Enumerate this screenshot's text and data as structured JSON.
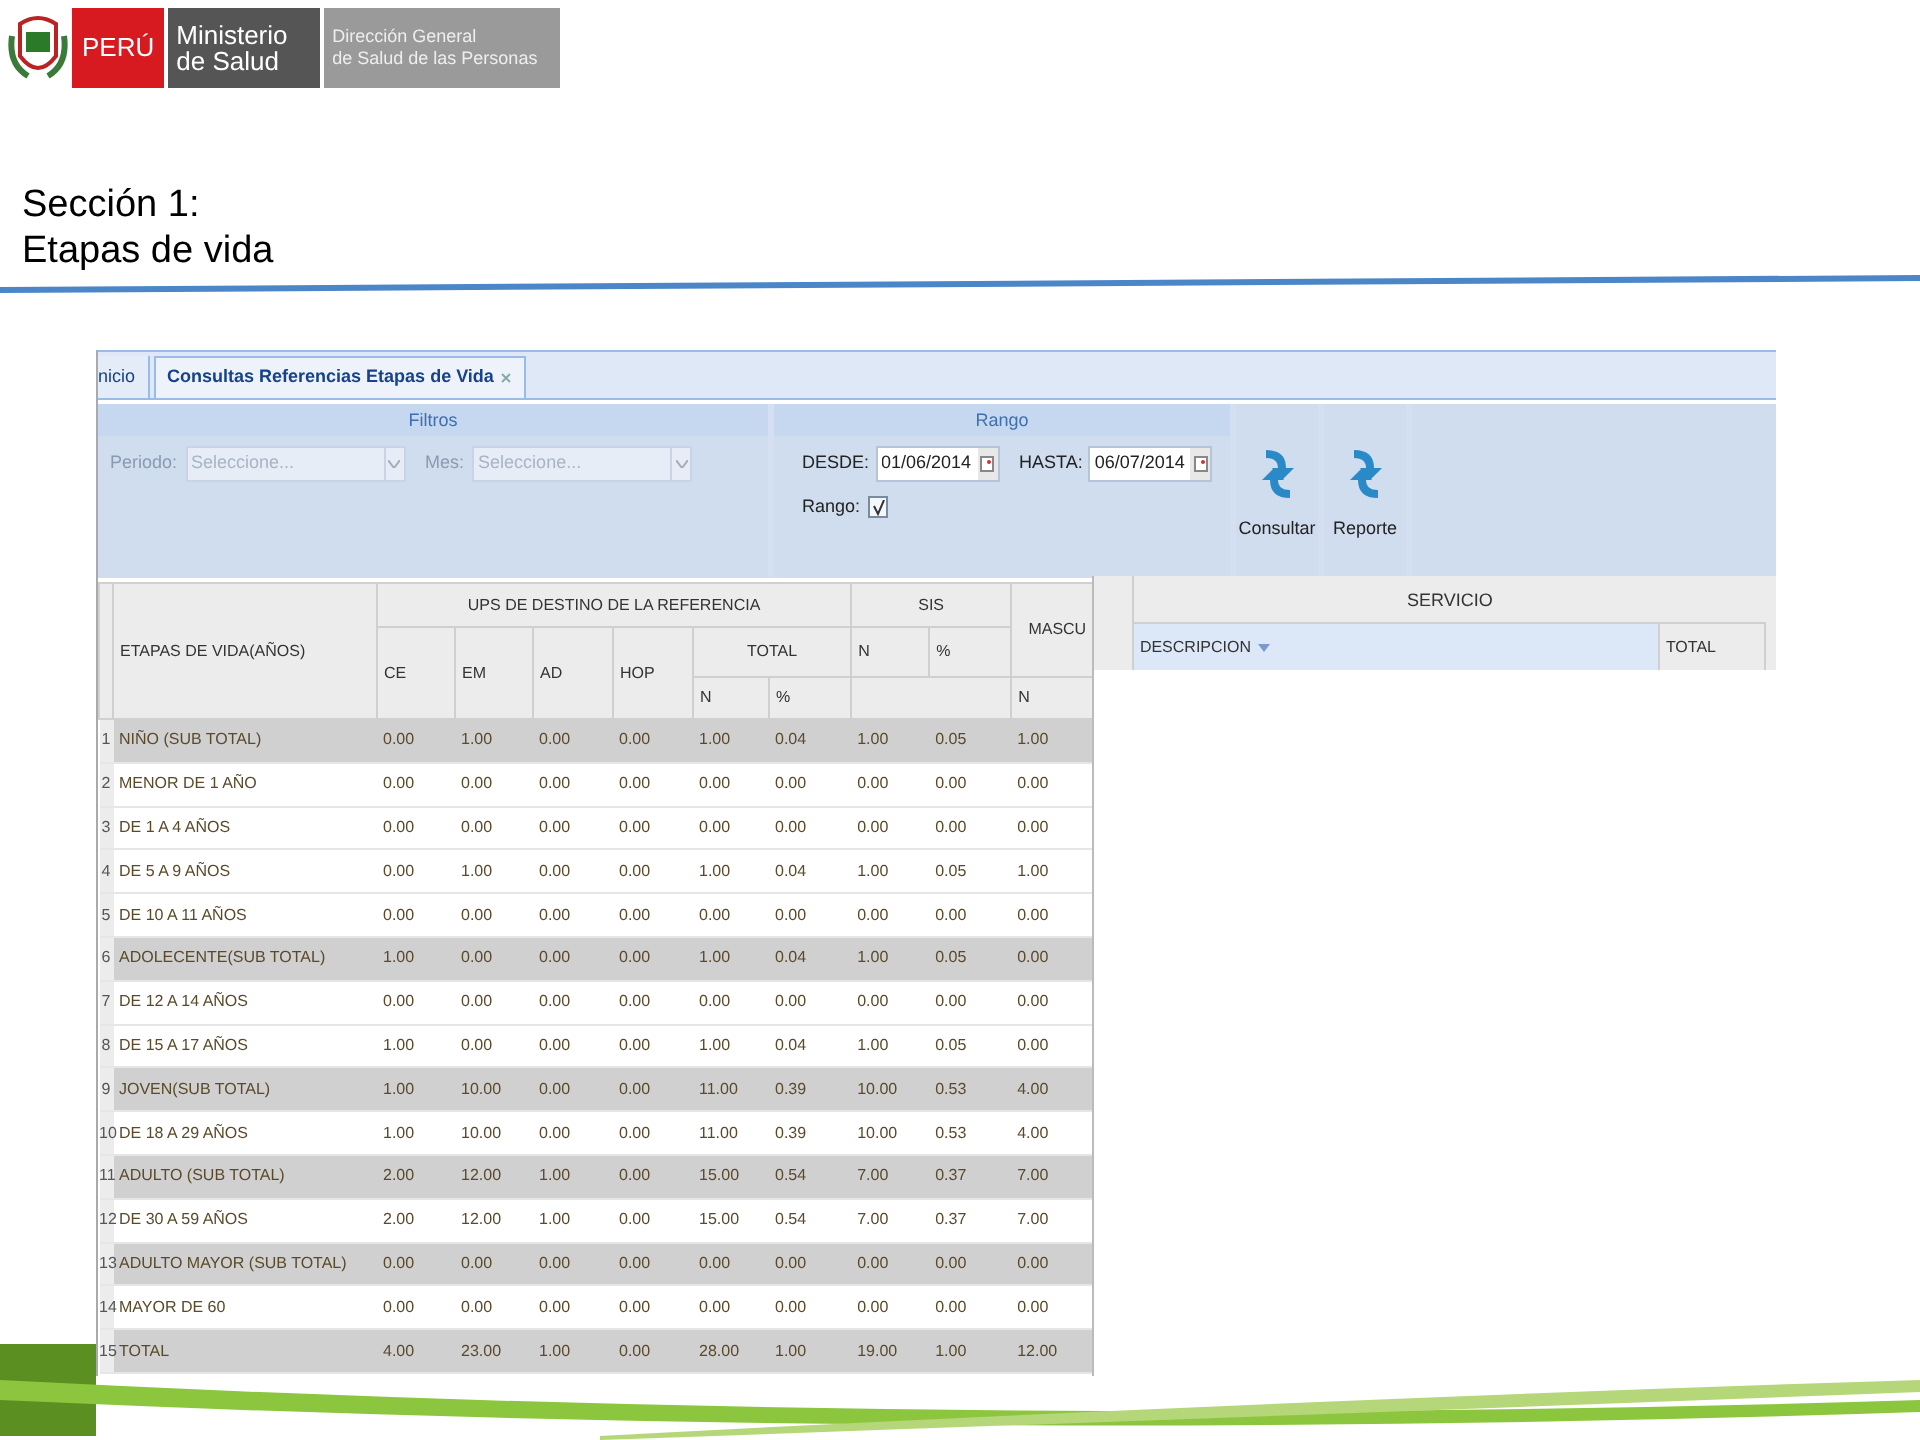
{
  "logo": {
    "country": "PERÚ",
    "ministry": [
      "Ministerio",
      "de Salud"
    ],
    "office": [
      "Dirección General",
      "de Salud de las Personas"
    ]
  },
  "slide_title": [
    "Sección 1:",
    "Etapas de vida"
  ],
  "tabs": [
    {
      "label": "nicio",
      "selected": false,
      "closable": false
    },
    {
      "label": "Consultas Referencias Etapas de Vida",
      "selected": true,
      "closable": true
    }
  ],
  "filters": {
    "title": "Filtros",
    "fields": [
      {
        "label": "Periodo:",
        "placeholder": "Seleccione...",
        "disabled": true
      },
      {
        "label": "Mes:",
        "placeholder": "Seleccione...",
        "disabled": true
      }
    ]
  },
  "range": {
    "title": "Rango",
    "dates": [
      {
        "label": "DESDE:",
        "value": "01/06/2014"
      },
      {
        "label": "HASTA:",
        "value": "06/07/2014"
      }
    ],
    "checkbox": {
      "label": "Rango:",
      "checked": true
    }
  },
  "actions": [
    {
      "label": "Consultar"
    },
    {
      "label": "Reporte"
    }
  ],
  "grid": {
    "header": {
      "stages": "ETAPAS DE VIDA(AÑOS)",
      "ups": "UPS DE DESTINO DE LA REFERENCIA",
      "ups_columns": [
        "CE",
        "EM",
        "AD",
        "HOP"
      ],
      "total": "TOTAL",
      "total_columns": [
        "N",
        "%"
      ],
      "sis": "SIS",
      "sis_columns": [
        "N",
        "%"
      ],
      "male": "MASCU",
      "male_columns": [
        "N"
      ]
    },
    "rows": [
      {
        "number": "1",
        "label": "NIÑO (SUB TOTAL)",
        "kind": "subtotal",
        "values": [
          "0.00",
          "1.00",
          "0.00",
          "0.00",
          "1.00",
          "0.04",
          "1.00",
          "0.05",
          "1.00"
        ]
      },
      {
        "number": "2",
        "label": "MENOR DE 1 AÑO",
        "kind": "detail",
        "values": [
          "0.00",
          "0.00",
          "0.00",
          "0.00",
          "0.00",
          "0.00",
          "0.00",
          "0.00",
          "0.00"
        ]
      },
      {
        "number": "3",
        "label": "DE 1 A 4 AÑOS",
        "kind": "detail",
        "values": [
          "0.00",
          "0.00",
          "0.00",
          "0.00",
          "0.00",
          "0.00",
          "0.00",
          "0.00",
          "0.00"
        ]
      },
      {
        "number": "4",
        "label": "DE 5 A 9 AÑOS",
        "kind": "detail",
        "values": [
          "0.00",
          "1.00",
          "0.00",
          "0.00",
          "1.00",
          "0.04",
          "1.00",
          "0.05",
          "1.00"
        ]
      },
      {
        "number": "5",
        "label": "DE 10 A 11 AÑOS",
        "kind": "detail",
        "values": [
          "0.00",
          "0.00",
          "0.00",
          "0.00",
          "0.00",
          "0.00",
          "0.00",
          "0.00",
          "0.00"
        ]
      },
      {
        "number": "6",
        "label": "ADOLECENTE(SUB TOTAL)",
        "kind": "subtotal",
        "values": [
          "1.00",
          "0.00",
          "0.00",
          "0.00",
          "1.00",
          "0.04",
          "1.00",
          "0.05",
          "0.00"
        ]
      },
      {
        "number": "7",
        "label": "DE 12 A 14 AÑOS",
        "kind": "detail",
        "values": [
          "0.00",
          "0.00",
          "0.00",
          "0.00",
          "0.00",
          "0.00",
          "0.00",
          "0.00",
          "0.00"
        ]
      },
      {
        "number": "8",
        "label": "DE 15 A 17 AÑOS",
        "kind": "detail",
        "values": [
          "1.00",
          "0.00",
          "0.00",
          "0.00",
          "1.00",
          "0.04",
          "1.00",
          "0.05",
          "0.00"
        ]
      },
      {
        "number": "9",
        "label": "JOVEN(SUB TOTAL)",
        "kind": "subtotal",
        "values": [
          "1.00",
          "10.00",
          "0.00",
          "0.00",
          "11.00",
          "0.39",
          "10.00",
          "0.53",
          "4.00"
        ]
      },
      {
        "number": "10",
        "label": "DE 18 A 29 AÑOS",
        "kind": "detail",
        "values": [
          "1.00",
          "10.00",
          "0.00",
          "0.00",
          "11.00",
          "0.39",
          "10.00",
          "0.53",
          "4.00"
        ]
      },
      {
        "number": "11",
        "label": "ADULTO (SUB TOTAL)",
        "kind": "subtotal",
        "values": [
          "2.00",
          "12.00",
          "1.00",
          "0.00",
          "15.00",
          "0.54",
          "7.00",
          "0.37",
          "7.00"
        ]
      },
      {
        "number": "12",
        "label": "DE 30 A 59 AÑOS",
        "kind": "detail",
        "values": [
          "2.00",
          "12.00",
          "1.00",
          "0.00",
          "15.00",
          "0.54",
          "7.00",
          "0.37",
          "7.00"
        ]
      },
      {
        "number": "13",
        "label": "ADULTO MAYOR (SUB TOTAL)",
        "kind": "subtotal",
        "values": [
          "0.00",
          "0.00",
          "0.00",
          "0.00",
          "0.00",
          "0.00",
          "0.00",
          "0.00",
          "0.00"
        ]
      },
      {
        "number": "14",
        "label": "MAYOR DE 60",
        "kind": "detail",
        "values": [
          "0.00",
          "0.00",
          "0.00",
          "0.00",
          "0.00",
          "0.00",
          "0.00",
          "0.00",
          "0.00"
        ]
      },
      {
        "number": "15",
        "label": "TOTAL",
        "kind": "subtotal",
        "values": [
          "4.00",
          "23.00",
          "1.00",
          "0.00",
          "28.00",
          "1.00",
          "19.00",
          "1.00",
          "12.00"
        ]
      }
    ]
  },
  "service_panel": {
    "title": "SERVICIO",
    "columns": [
      {
        "label": "DESCRIPCION",
        "sorted": true
      },
      {
        "label": "TOTAL",
        "sorted": false
      }
    ]
  }
}
